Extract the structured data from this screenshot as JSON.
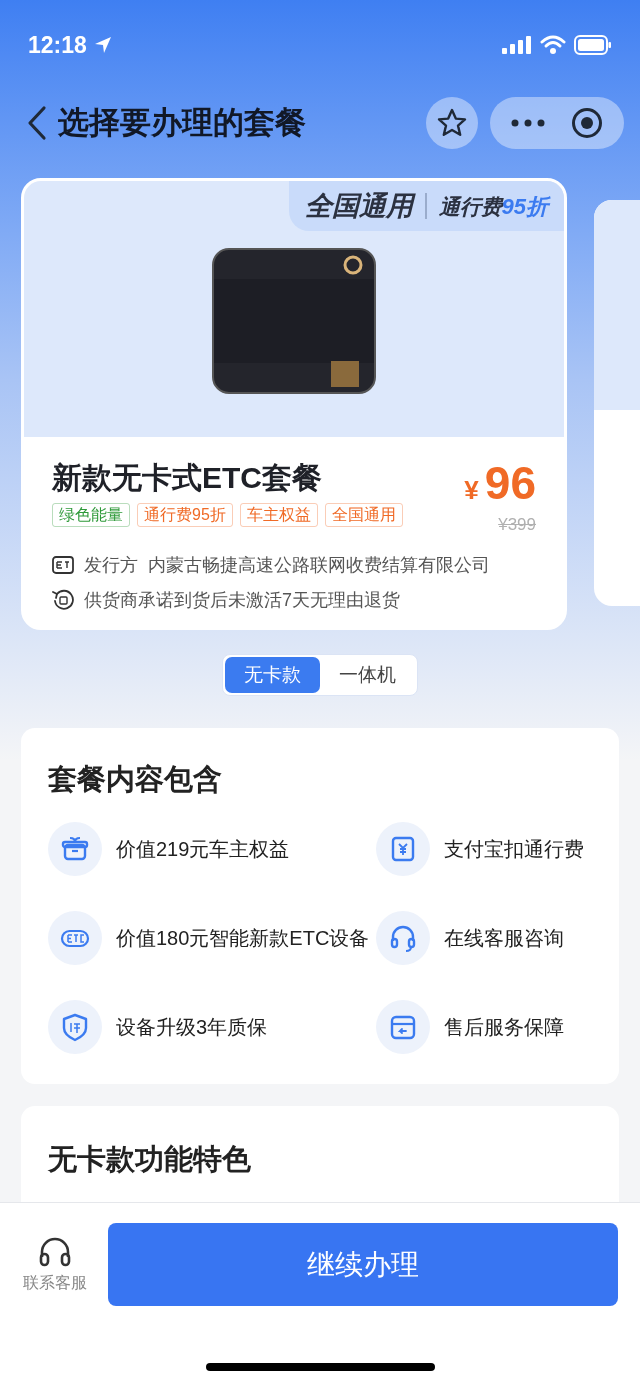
{
  "status_bar": {
    "time": "12:18"
  },
  "header": {
    "title": "选择要办理的套餐"
  },
  "product_card": {
    "banner": {
      "scope": "全国通用",
      "discount_label": "通行费",
      "discount_value": "95折"
    },
    "title": "新款无卡式ETC套餐",
    "price_symbol": "¥",
    "price": "96",
    "original_price": "¥399",
    "tags": [
      {
        "label": "绿色能量",
        "color": "#2f9a3a"
      },
      {
        "label": "通行费95折",
        "color": "#f06a26"
      },
      {
        "label": "车主权益",
        "color": "#f06a26"
      },
      {
        "label": "全国通用",
        "color": "#f06a26"
      }
    ],
    "info": [
      {
        "kind": "issuer",
        "label": "发行方",
        "text": "内蒙古畅捷高速公路联网收费结算有限公司"
      },
      {
        "kind": "return",
        "text": "供货商承诺到货后未激活7天无理由退货"
      }
    ]
  },
  "segments": [
    {
      "label": "无卡款",
      "selected": true
    },
    {
      "label": "一体机",
      "selected": false
    }
  ],
  "package_contents": {
    "title": "套餐内容包含",
    "items": [
      {
        "kind": "gift",
        "text": "价值219元车主权益"
      },
      {
        "kind": "yuan",
        "text": "支付宝扣通行费"
      },
      {
        "kind": "etc",
        "text": "价值180元智能新款ETC设备"
      },
      {
        "kind": "headset",
        "text": "在线客服咨询"
      },
      {
        "kind": "shield",
        "text": "设备升级3年质保"
      },
      {
        "kind": "box",
        "text": "售后服务保障"
      }
    ]
  },
  "features": {
    "title": "无卡款功能特色"
  },
  "bottom_bar": {
    "service_label": "联系客服",
    "continue_button": "继续办理"
  }
}
